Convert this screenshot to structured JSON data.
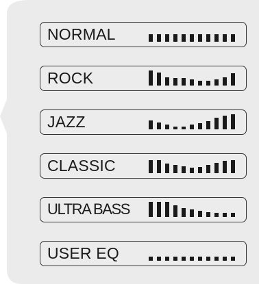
{
  "eq_presets": [
    {
      "label": "NORMAL",
      "levels": [
        0.5,
        0.5,
        0.5,
        0.5,
        0.5,
        0.5,
        0.5,
        0.5,
        0.5,
        0.5,
        0.5
      ]
    },
    {
      "label": "ROCK",
      "levels": [
        1,
        0.85,
        0.55,
        0.5,
        0.5,
        0.4,
        0.3,
        0.3,
        0.4,
        0.55,
        0.8
      ]
    },
    {
      "label": "JAZZ",
      "levels": [
        0.6,
        0.45,
        0.3,
        0.2,
        0.2,
        0.3,
        0.4,
        0.55,
        0.75,
        0.9,
        1
      ]
    },
    {
      "label": "CLASSIC",
      "levels": [
        0.85,
        0.85,
        0.65,
        0.55,
        0.45,
        0.35,
        0.4,
        0.55,
        0.7,
        0.8,
        0.85
      ]
    },
    {
      "label": "ULTRA BASS",
      "levels": [
        1,
        1,
        1,
        0.75,
        0.6,
        0.5,
        0.4,
        0.3,
        0.25,
        0.25,
        0.25
      ]
    },
    {
      "label": "USER EQ",
      "levels": [
        0.25,
        0.25,
        0.25,
        0.25,
        0.25,
        0.25,
        0.25,
        0.25,
        0.25,
        0.25,
        0.25
      ]
    }
  ],
  "colors": {
    "panel": "#ebebeb",
    "item_bg": "#ececec",
    "border": "#333333",
    "text": "#1a1a1a"
  }
}
